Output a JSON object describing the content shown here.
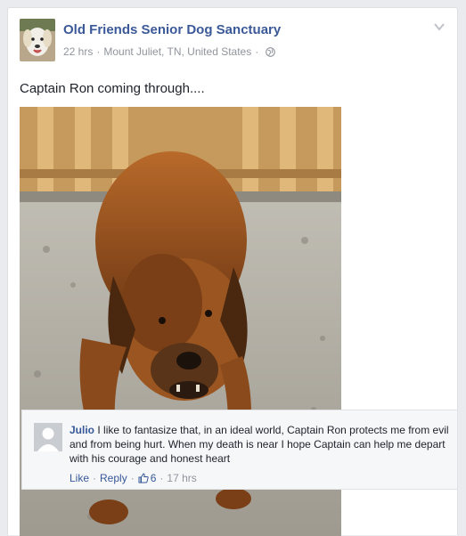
{
  "post": {
    "page_name": "Old Friends Senior Dog Sanctuary",
    "time": "22 hrs",
    "location": "Mount Juliet, TN, United States",
    "audience_icon": "globe-icon",
    "text": "Captain Ron coming through...."
  },
  "comment": {
    "author": "Julio",
    "text": "I like to fantasize that, in an ideal world, Captain Ron protects me from evil and from being hurt. When my death is near I hope Captain can help me depart with his courage and honest heart",
    "like_label": "Like",
    "reply_label": "Reply",
    "like_count": "6",
    "time": "17 hrs"
  },
  "colors": {
    "link": "#3b5998",
    "meta": "#90949c",
    "background": "#e9ebee"
  }
}
